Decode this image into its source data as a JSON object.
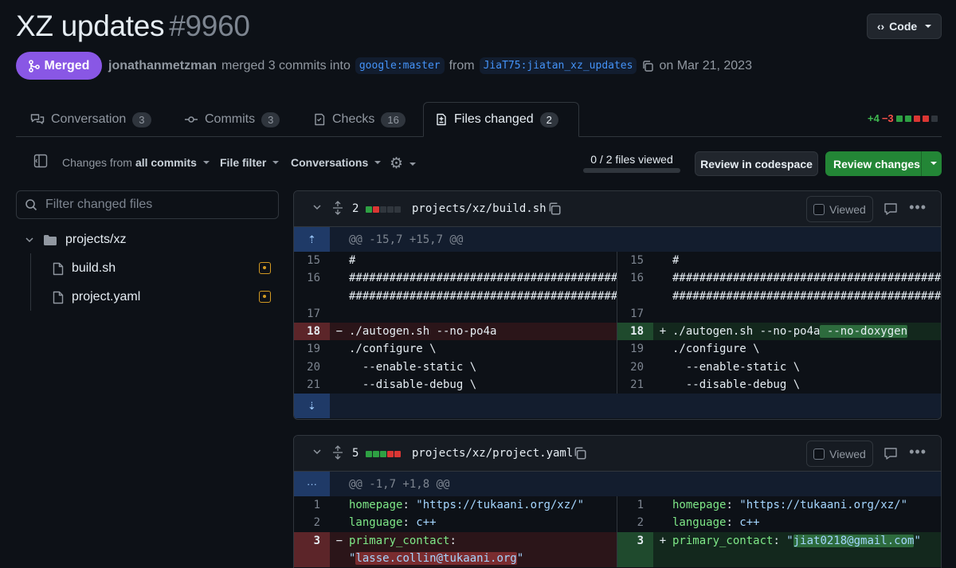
{
  "header": {
    "title": "XZ updates",
    "number": "#9960",
    "code_button": "Code",
    "state": "Merged",
    "author": "jonathanmetzman",
    "action": "merged 3 commits into",
    "base_branch": "google:master",
    "from_word": "from",
    "head_branch": "JiaT75:jiatan_xz_updates",
    "date": "on Mar 21, 2023"
  },
  "tabs": [
    {
      "label": "Conversation",
      "count": "3"
    },
    {
      "label": "Commits",
      "count": "3"
    },
    {
      "label": "Checks",
      "count": "16"
    },
    {
      "label": "Files changed",
      "count": "2"
    }
  ],
  "diffstat": {
    "plus": "+4",
    "minus": "−3"
  },
  "toolbar": {
    "changes_prefix": "Changes from",
    "changes_value": "all commits",
    "file_filter": "File filter",
    "conversations": "Conversations",
    "viewed_count": "0 / 2 files viewed",
    "review_codespace": "Review in codespace",
    "review_changes": "Review changes"
  },
  "sidebar": {
    "filter_placeholder": "Filter changed files",
    "folder": "projects/xz",
    "files": [
      "build.sh",
      "project.yaml"
    ]
  },
  "files": [
    {
      "changes": "2",
      "path": "projects/xz/build.sh",
      "viewed_label": "Viewed",
      "hunk": "@@ -15,7 +15,7 @@",
      "left": {
        "l15": "15",
        "c15": "#",
        "l16": "16",
        "c16a": "########################################",
        "c16b": "########################################",
        "l17": "17",
        "l18": "18",
        "c18": "./autogen.sh --no-po4a",
        "l19": "19",
        "c19": "./configure \\",
        "l20": "20",
        "c20": "  --enable-static \\",
        "l21": "21",
        "c21": "  --disable-debug \\"
      },
      "right": {
        "l15": "15",
        "c15": "#",
        "l16": "16",
        "c16a": "########################################",
        "c16b": "########################################",
        "l17": "17",
        "l18": "18",
        "c18": "./autogen.sh --no-po4a",
        "c18add": " --no-doxygen",
        "l19": "19",
        "c19": "./configure \\",
        "l20": "20",
        "c20": "  --enable-static \\",
        "l21": "21",
        "c21": "  --disable-debug \\"
      }
    },
    {
      "changes": "5",
      "path": "projects/xz/project.yaml",
      "viewed_label": "Viewed",
      "hunk": "@@ -1,7 +1,8 @@",
      "left": {
        "l1": "1",
        "k1": "homepage",
        "v1": "\"https://tukaani.org/xz/\"",
        "l2": "2",
        "k2": "language",
        "v2": "c++",
        "l3": "3",
        "k3": "primary_contact",
        "v3": "lasse.collin@tukaani.org"
      },
      "right": {
        "l1": "1",
        "k1": "homepage",
        "v1": "\"https://tukaani.org/xz/\"",
        "l2": "2",
        "k2": "language",
        "v2": "c++",
        "l3": "3",
        "k3": "primary_contact",
        "v3": "jiat0218@gmail.com"
      }
    }
  ]
}
